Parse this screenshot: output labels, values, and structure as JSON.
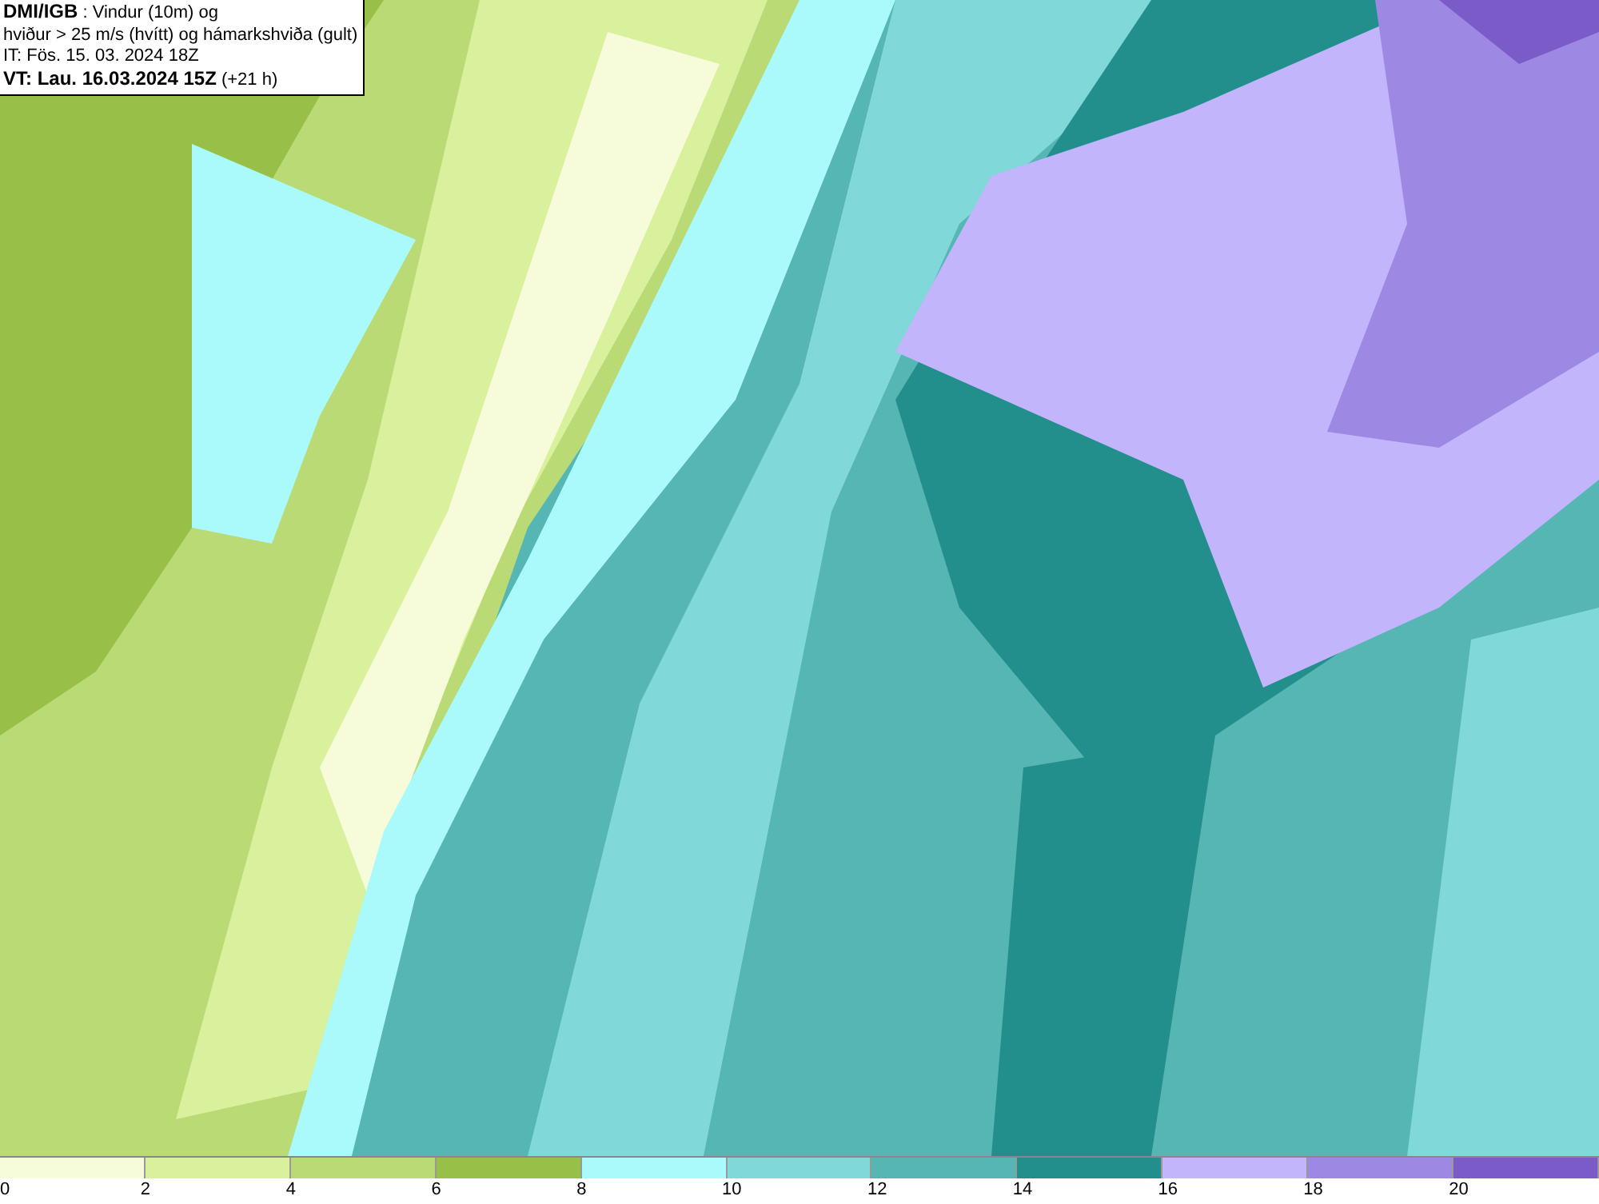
{
  "header": {
    "lines": [
      "**DMI/IGB** : Vindur (10m) og",
      "hviður > 25 m/s (hvítt) og hámarkshviða (gult)",
      "IT: Fös. 15. 03. 2024 18Z",
      "**VT: Lau. 16.03.2024 15Z** (+21 h)"
    ]
  },
  "legend": {
    "segments": [
      {
        "color": "#f6fbd9"
      },
      {
        "color": "#d9f09c"
      },
      {
        "color": "#b9da74"
      },
      {
        "color": "#98bf48"
      },
      {
        "color": "#aaf9fb"
      },
      {
        "color": "#80d8d8"
      },
      {
        "color": "#56b6b4"
      },
      {
        "color": "#238f8c"
      },
      {
        "color": "#c2b5fb"
      },
      {
        "color": "#9d88e3"
      },
      {
        "color": "#7b5bc8"
      }
    ],
    "ticks": [
      "0",
      "2",
      "4",
      "6",
      "8",
      "10",
      "12",
      "14",
      "16",
      "18",
      "20"
    ]
  }
}
